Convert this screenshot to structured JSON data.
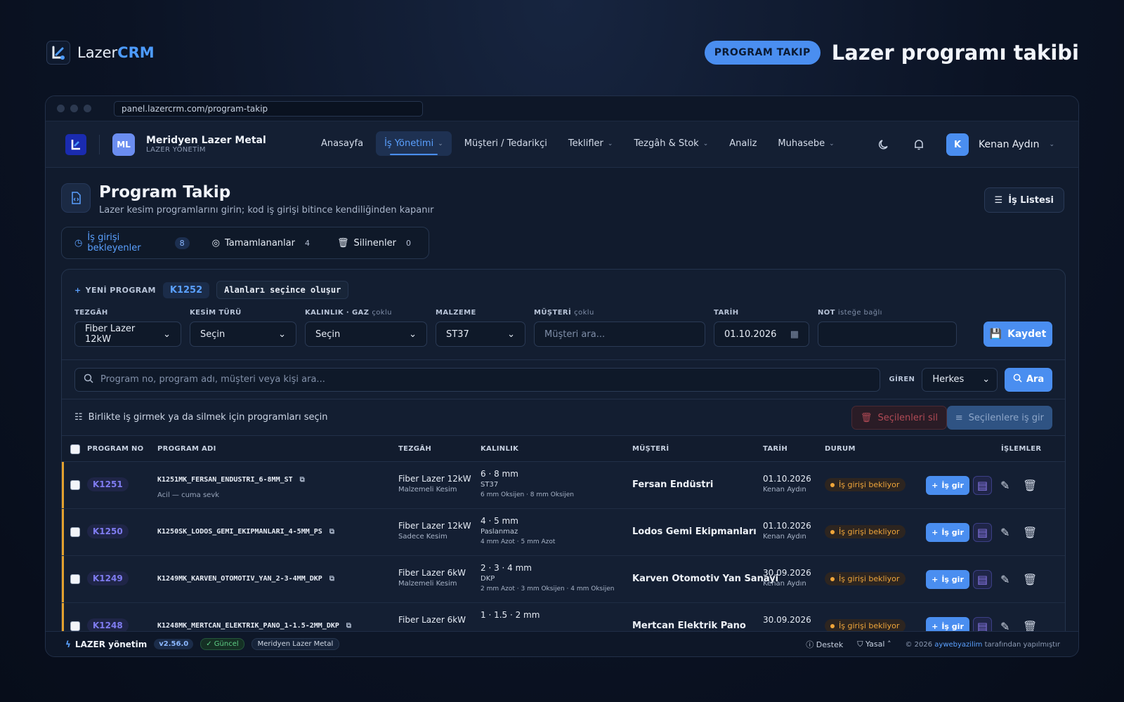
{
  "brand": {
    "prefix": "Lazer",
    "suffix": "CRM"
  },
  "hero": {
    "badge": "PROGRAM TAKIP",
    "title": "Lazer programı takibi"
  },
  "browser": {
    "url": "panel.lazercrm.com/program-takip"
  },
  "company": {
    "initials": "ML",
    "name": "Meridyen Lazer Metal",
    "sub": "LAZER YÖNETİM"
  },
  "nav": {
    "items": [
      {
        "label": "Anasayfa"
      },
      {
        "label": "İş Yönetimi"
      },
      {
        "label": "Müşteri / Tedarikçi"
      },
      {
        "label": "Teklifler"
      },
      {
        "label": "Tezgâh & Stok"
      },
      {
        "label": "Analiz"
      },
      {
        "label": "Muhasebe"
      }
    ]
  },
  "user": {
    "initial": "K",
    "name": "Kenan Aydın"
  },
  "page": {
    "title": "Program Takip",
    "subtitle": "Lazer kesim programlarını girin; kod iş girişi bitince kendiliğinden kapanır",
    "list_button": "İş Listesi"
  },
  "tabs": [
    {
      "label": "İş girişi bekleyenler",
      "count": "8"
    },
    {
      "label": "Tamamlananlar",
      "count": "4"
    },
    {
      "label": "Silinenler",
      "count": "0"
    }
  ],
  "new_program": {
    "label": "YENİ PROGRAM",
    "code": "K1252",
    "hint": "Alanları seçince oluşur"
  },
  "form": {
    "bench": {
      "label": "TEZGÂH",
      "value": "Fiber Lazer 12kW"
    },
    "cut": {
      "label": "KESİM TÜRÜ",
      "value": "Seçin"
    },
    "thickness": {
      "label": "KALINLIK · GAZ",
      "note": "çoklu",
      "value": "Seçin"
    },
    "material": {
      "label": "MALZEME",
      "value": "ST37"
    },
    "customer": {
      "label": "MÜŞTERİ",
      "note": "çoklu",
      "placeholder": "Müşteri ara..."
    },
    "date": {
      "label": "TARİH",
      "value": "01.10.2026"
    },
    "note": {
      "label": "NOT",
      "note": "isteğe bağlı",
      "value": ""
    },
    "save": "Kaydet"
  },
  "search": {
    "placeholder": "Program no, program adı, müşteri veya kişi ara...",
    "giren_label": "GİREN",
    "giren_value": "Herkes",
    "button": "Ara"
  },
  "bulk": {
    "text": "Birlikte iş girmek ya da silmek için programları seçin",
    "delete": "Seçilenleri sil",
    "enter": "Seçilenlere iş gir"
  },
  "table": {
    "headers": [
      "PROGRAM NO",
      "PROGRAM ADI",
      "TEZGÂH",
      "KALINLIK",
      "MÜŞTERİ",
      "TARİH",
      "DURUM",
      "İŞLEMLER"
    ],
    "action_label": "İş gir",
    "rows": [
      {
        "code": "K1251",
        "name": "K1251MK_FERSAN_ENDUSTRI_6-8MM_ST",
        "note": "Acil — cuma sevk",
        "bench": "Fiber Lazer 12kW",
        "cut": "Malzemeli Kesim",
        "thick": "6 · 8 mm",
        "mat": "ST37",
        "gas": "6 mm Oksijen · 8 mm Oksijen",
        "customer": "Fersan Endüstri",
        "date": "01.10.2026",
        "by": "Kenan Aydın",
        "status": "İş girişi bekliyor"
      },
      {
        "code": "K1250",
        "name": "K1250SK_LODOS_GEMI_EKIPMANLARI_4-5MM_PS",
        "note": "",
        "bench": "Fiber Lazer 12kW",
        "cut": "Sadece Kesim",
        "thick": "4 · 5 mm",
        "mat": "Paslanmaz",
        "gas": "4 mm Azot · 5 mm Azot",
        "customer": "Lodos Gemi Ekipmanları",
        "date": "01.10.2026",
        "by": "Kenan Aydın",
        "status": "İş girişi bekliyor"
      },
      {
        "code": "K1249",
        "name": "K1249MK_KARVEN_OTOMOTIV_YAN_2-3-4MM_DKP",
        "note": "",
        "bench": "Fiber Lazer 6kW",
        "cut": "Malzemeli Kesim",
        "thick": "2 · 3 · 4 mm",
        "mat": "DKP",
        "gas": "2 mm Azot · 3 mm Oksijen · 4 mm Oksijen",
        "customer": "Karven Otomotiv Yan Sanayi",
        "date": "30.09.2026",
        "by": "Kenan Aydın",
        "status": "İş girişi bekliyor"
      },
      {
        "code": "K1248",
        "name": "K1248MK_MERTCAN_ELEKTRIK_PANO_1-1.5-2MM_DKP",
        "note": "",
        "bench": "Fiber Lazer 6kW",
        "cut": "",
        "thick": "1 · 1.5 · 2 mm",
        "mat": "",
        "gas": "",
        "customer": "Mertcan Elektrik Pano",
        "date": "30.09.2026",
        "by": "",
        "status": "İş girişi bekliyor"
      }
    ]
  },
  "footer": {
    "brand": "LAZER yönetim",
    "version": "v2.56.0",
    "status": "Güncel",
    "company": "Meridyen Lazer Metal",
    "support": "Destek",
    "legal": "Yasal",
    "copyright_prefix": "© 2026",
    "copyright_link": "aywebyazilim",
    "copyright_suffix": "tarafından yapılmıştır"
  }
}
